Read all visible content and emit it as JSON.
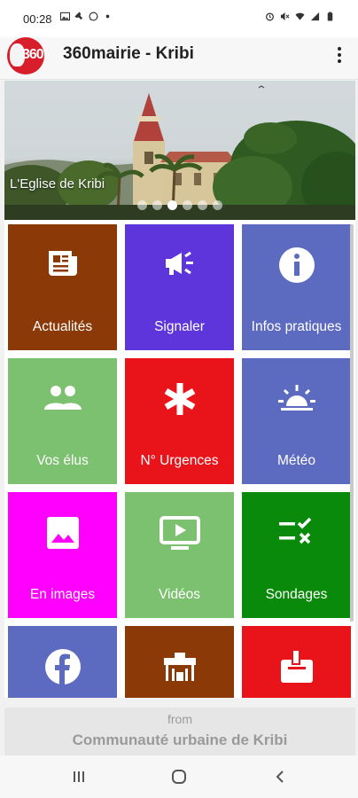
{
  "status_bar": {
    "time": "00:28",
    "left_icons": [
      "gallery-icon",
      "cast-icon",
      "whatsapp-icon",
      "dot-icon"
    ],
    "right_icons": [
      "alarm-icon",
      "mute-icon",
      "wifi-icon",
      "signal-icon",
      "battery-icon"
    ]
  },
  "app_bar": {
    "logo_text": "360",
    "title": "360mairie - Kribi"
  },
  "carousel": {
    "caption": "L'Eglise de Kribi",
    "slide_count": 6,
    "active_index": 2
  },
  "tiles": [
    {
      "label": "Actualités",
      "icon": "newspaper-icon",
      "color": "#8B3A07"
    },
    {
      "label": "Signaler",
      "icon": "megaphone-icon",
      "color": "#5E35DA"
    },
    {
      "label": "Infos pratiques",
      "icon": "info-icon",
      "color": "#5C6BC0"
    },
    {
      "label": "Vos élus",
      "icon": "people-icon",
      "color": "#7CC16F"
    },
    {
      "label": "N° Urgences",
      "icon": "asterisk-icon",
      "color": "#E8141A"
    },
    {
      "label": "Météo",
      "icon": "sunrise-icon",
      "color": "#5C6BC0"
    },
    {
      "label": "En images",
      "icon": "image-icon",
      "color": "#FF00FF"
    },
    {
      "label": "Vidéos",
      "icon": "video-icon",
      "color": "#7CC16F"
    },
    {
      "label": "Sondages",
      "icon": "poll-icon",
      "color": "#0A8A0A"
    },
    {
      "label": "",
      "icon": "facebook-icon",
      "color": "#5C6BC0"
    },
    {
      "label": "",
      "icon": "building-icon",
      "color": "#8B3A07"
    },
    {
      "label": "",
      "icon": "mailbox-icon",
      "color": "#E8141A"
    }
  ],
  "footer": {
    "from": "from",
    "organization": "Communauté urbaine de Kribi"
  },
  "nav_bar": {
    "buttons": [
      "recents-icon",
      "home-icon",
      "back-icon"
    ]
  }
}
